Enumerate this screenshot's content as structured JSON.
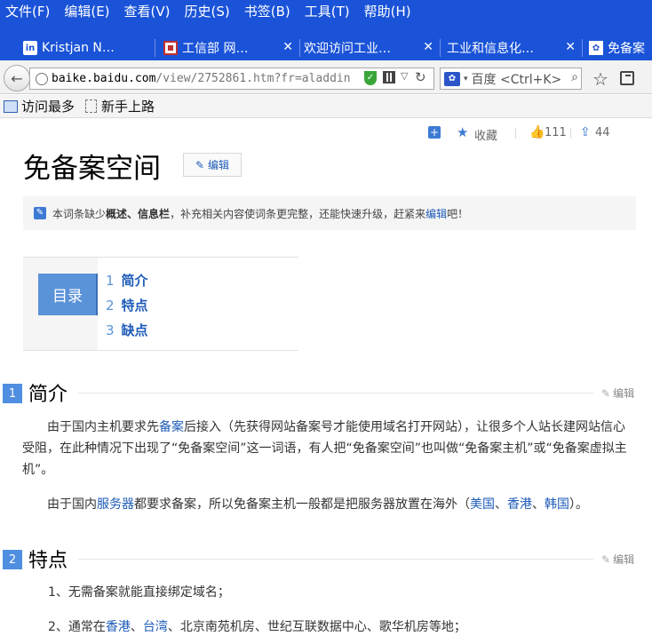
{
  "menubar": {
    "items": [
      "文件(F)",
      "编辑(E)",
      "查看(V)",
      "历史(S)",
      "书签(B)",
      "工具(T)",
      "帮助(H)"
    ]
  },
  "tabs": [
    {
      "label": "Kristjan N…",
      "icon": "linkedin-icon"
    },
    {
      "label": "工信部 网…",
      "icon": "gov-icon"
    },
    {
      "label": "欢迎访问工业…",
      "icon": "none"
    },
    {
      "label": "工业和信息化…",
      "icon": "none"
    },
    {
      "label": "免备案",
      "icon": "baidu-paw-icon"
    }
  ],
  "navbar": {
    "url_host": "baike.baidu.com",
    "url_rest": "/view/2752861.htm?fr=aladdin",
    "search_engine": "百度",
    "search_placeholder": "百度 <Ctrl+K>"
  },
  "bookmarks": [
    {
      "label": "访问最多",
      "icon": "folder-icon"
    },
    {
      "label": "新手上路",
      "icon": "page-icon"
    }
  ],
  "article": {
    "actions": {
      "favorite_label": "收藏",
      "like_count": "111",
      "share_count": "44"
    },
    "title": "免备案空间",
    "edit_label": "编辑",
    "notice": {
      "prefix": "本词条缺少",
      "bold1": "概述",
      "sep": "、",
      "bold2": "信息栏",
      "middle": "，补充相关内容使词条更完整，还能快速升级，赶紧来",
      "link": "编辑",
      "suffix": "吧！"
    },
    "toc": {
      "label": "目录",
      "items": [
        {
          "num": "1",
          "title": "简介"
        },
        {
          "num": "2",
          "title": "特点"
        },
        {
          "num": "3",
          "title": "缺点"
        }
      ]
    },
    "sections": [
      {
        "num": "1",
        "title": "简介",
        "edit": "编辑"
      },
      {
        "num": "2",
        "title": "特点",
        "edit": "编辑"
      }
    ],
    "intro": {
      "p1_a": "由于国内主机要求先",
      "p1_link": "备案",
      "p1_b": "后接入（先获得网站备案号才能使用域名打开网站），让很多个人站长建网站信心受阻，在此种情况下出现了“免备案空间”这一词语，有人把“免备案空间”也叫做“免备案主机”或“免备案虚拟主机”。",
      "p2_a": "由于国内",
      "p2_link1": "服务器",
      "p2_b": "都要求备案，所以免备案主机一般都是把服务器放置在海外（",
      "p2_link2": "美国",
      "p2_sep1": "、",
      "p2_link3": "香港",
      "p2_sep2": "、",
      "p2_link4": "韩国",
      "p2_c": "）。"
    },
    "features": {
      "f1": "1、无需备案就能直接绑定域名；",
      "f2_a": "2、通常在",
      "f2_link1": "香港",
      "f2_sep": "、",
      "f2_link2": "台湾",
      "f2_b": "、北京南苑机房、世纪互联数据中心、歌华机房等地；"
    }
  },
  "colors": {
    "chrome_blue": "#1a53d8",
    "link_blue": "#1e5bb8",
    "badge_blue": "#5b93d9"
  }
}
